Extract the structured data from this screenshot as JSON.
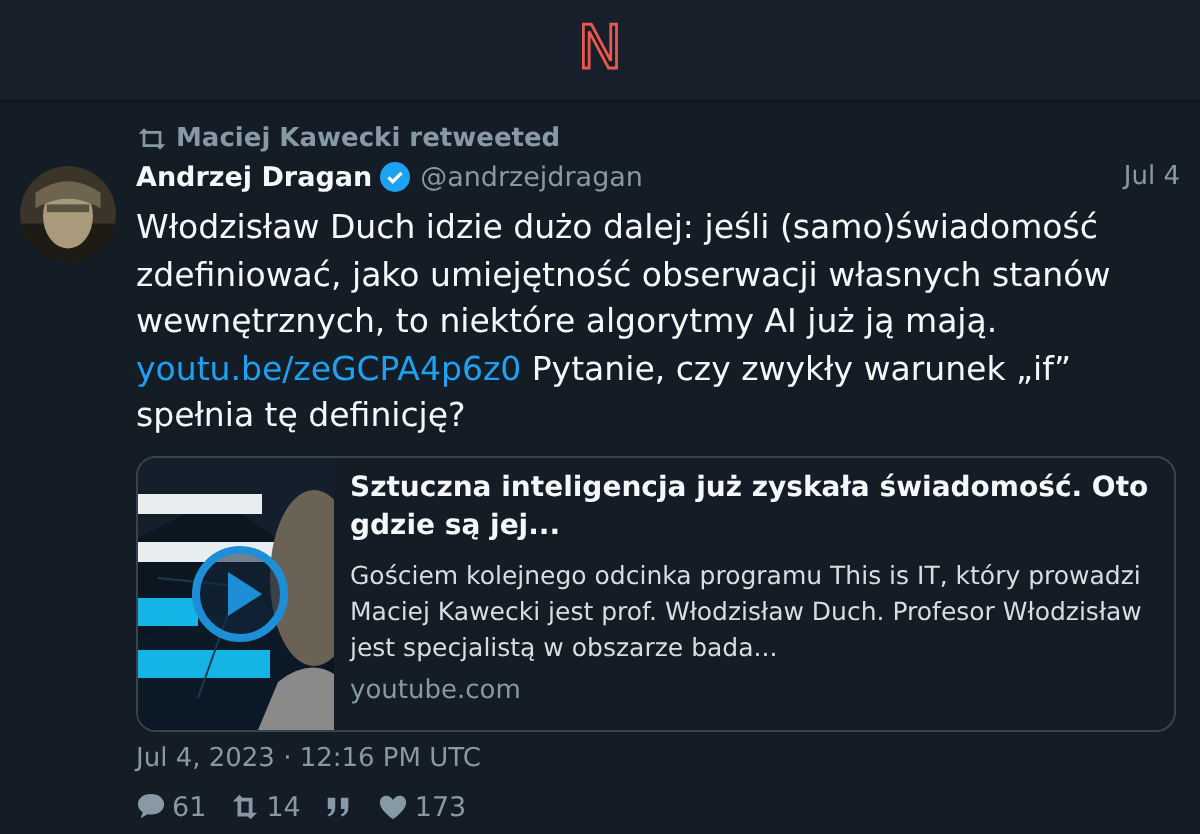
{
  "header": {
    "logo": "N"
  },
  "tweet": {
    "retweeted_by": "Maciej Kawecki retweeted",
    "author": "Andrzej Dragan",
    "verified": true,
    "handle": "@andrzejdragan",
    "date": "Jul 4",
    "body": [
      {
        "kind": "text",
        "text": "Włodzisław Duch idzie dużo dalej: jeśli (samo)świadomość zdefiniować, jako umiejętność obserwacji własnych stanów wewnętrznych, to niektóre algorytmy AI już ją mają. "
      },
      {
        "kind": "link",
        "text": "youtu.be/zeGCPA4p6z0"
      },
      {
        "kind": "text",
        "text": " Pytanie, czy zwykły warunek „if” spełnia tę definicję?"
      }
    ],
    "card": {
      "kind": "picture",
      "title": "Sztuczna inteligencja już zyskała świadomość. Oto gdzie są jej...",
      "description": "Gościem kolejnego odcinka programu This is IT, który prowadzi Maciej Kawecki jest prof. Włodzisław Duch. Profesor Włodzisław jest specjalistą w obszarze bada...",
      "domain": "youtube.com"
    },
    "timestamp": "Jul 4, 2023 · 12:16 PM UTC",
    "stats": [
      {
        "kind": "reply",
        "count": "61"
      },
      {
        "kind": "retweet",
        "count": "14"
      },
      {
        "kind": "quote"
      },
      {
        "kind": "like",
        "count": "173"
      }
    ]
  }
}
